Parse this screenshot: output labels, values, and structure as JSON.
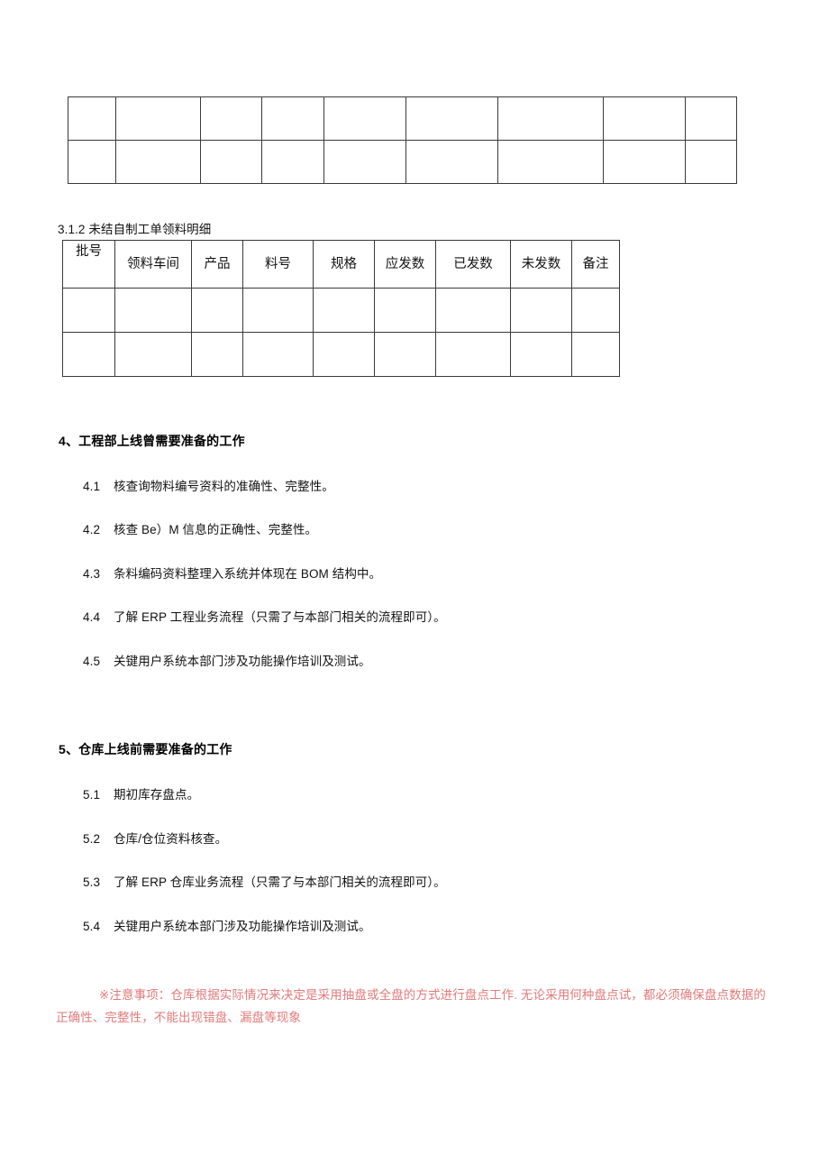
{
  "document": {
    "tables": {
      "top_table": {
        "name": "empty-continuation-table",
        "columns": 9,
        "rows": 2,
        "cells": [
          [
            "",
            "",
            "",
            "",
            "",
            "",
            "",
            "",
            ""
          ],
          [
            "",
            "",
            "",
            "",
            "",
            "",
            "",
            "",
            ""
          ]
        ]
      },
      "materials_table": {
        "caption": "3.1.2 未结自制工单领料明细",
        "headers": [
          "批号",
          "领料车间",
          "产品",
          "料号",
          "规格",
          "应发数",
          "已发数",
          "未发数",
          "备注"
        ],
        "rows": [
          [
            "",
            "",
            "",
            "",
            "",
            "",
            "",
            "",
            ""
          ],
          [
            "",
            "",
            "",
            "",
            "",
            "",
            "",
            "",
            ""
          ]
        ]
      }
    },
    "sections": [
      {
        "heading": "4、工程部上线曾需要准备的工作",
        "items": [
          {
            "num": "4.1",
            "text": "核查询物料编号资料的准确性、完整性。"
          },
          {
            "num": "4.2",
            "text": "核查 Be）M 信息的正确性、完整性。"
          },
          {
            "num": "4.3",
            "text": "条料编码资料整理入系统并体现在 BOM 结构中。"
          },
          {
            "num": "4.4",
            "text": "了解 ERP 工程业务流程（只需了与本部门相关的流程即可）。"
          },
          {
            "num": "4.5",
            "text": "关键用户系统本部门涉及功能操作培训及测试。"
          }
        ]
      },
      {
        "heading": "5、仓库上线前需要准备的工作",
        "items": [
          {
            "num": "5.1",
            "text": "期初库存盘点。"
          },
          {
            "num": "5.2",
            "text": "仓库/仓位资料核查。"
          },
          {
            "num": "5.3",
            "text": "了解 ERP 仓库业务流程（只需了与本部门相关的流程即可）。"
          },
          {
            "num": "5.4",
            "text": "关键用户系统本部门涉及功能操作培训及测试。"
          }
        ]
      }
    ],
    "note": {
      "text": "※注意事项：仓库根据实际情况来决定是采用抽盘或全盘的方式进行盘点工作. 无论采用何种盘点试，都必须确保盘点数据的正确性、完整性，不能出现错盘、漏盘等现象",
      "color": "#e27a7a"
    }
  }
}
